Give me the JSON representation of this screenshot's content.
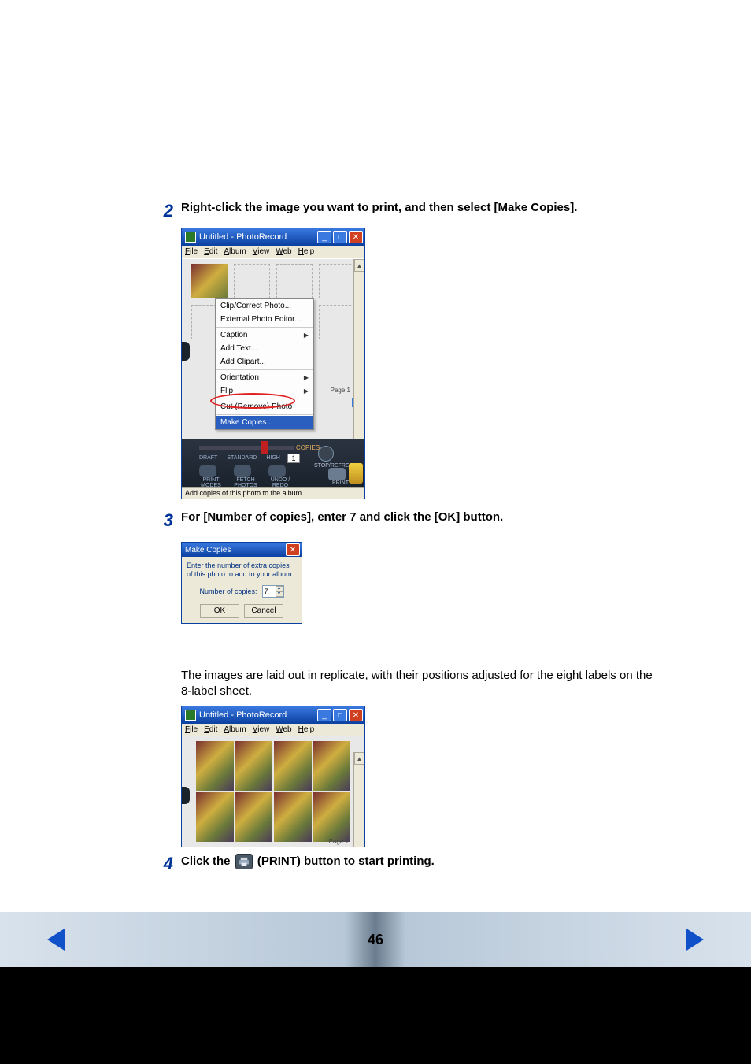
{
  "steps": {
    "s2": {
      "num": "2",
      "text": "Right-click the image you want to print, and then select [Make Copies]."
    },
    "s3": {
      "num": "3",
      "text": "For [Number of copies], enter 7 and click the [OK] button."
    },
    "s3caption": "The images are laid out in replicate, with their positions adjusted for the eight labels on the 8-label sheet.",
    "s4": {
      "num": "4",
      "pre": "Click the ",
      "post": "(PRINT) button to start printing."
    }
  },
  "appwin": {
    "title": "Untitled - PhotoRecord",
    "menus": {
      "file": "File",
      "edit": "Edit",
      "album": "Album",
      "view": "View",
      "web": "Web",
      "help": "Help"
    },
    "pagebadge": "Page 1",
    "status": "Add copies of this photo to the album"
  },
  "contextmenu": {
    "clip": "Clip/Correct Photo...",
    "external": "External Photo Editor...",
    "caption": "Caption",
    "addtext": "Add Text...",
    "addclipart": "Add Clipart...",
    "orientation": "Orientation",
    "flip": "Flip",
    "cut": "Cut (Remove) Photo",
    "makecopies": "Make Copies..."
  },
  "bottombar": {
    "draft": "DRAFT",
    "standard": "STANDARD",
    "high": "HIGH",
    "copies": "COPIES",
    "copiesval": "1",
    "stop": "STOP/REFRESH",
    "printmodes": "PRINT MODES",
    "fetch": "FETCH PHOTOS",
    "undo": "UNDO / REDO",
    "print": "PRINT"
  },
  "dialog": {
    "title": "Make Copies",
    "msg": "Enter the number of extra copies of this photo to add to your album.",
    "label": "Number of copies:",
    "value": "7",
    "ok": "OK",
    "cancel": "Cancel"
  },
  "footer": {
    "page": "46"
  }
}
